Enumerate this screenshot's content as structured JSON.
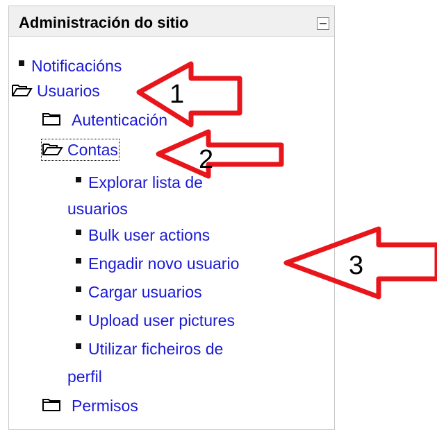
{
  "block": {
    "title": "Administración do sitio",
    "toggle_icon": "collapse-icon"
  },
  "tree": {
    "notifications": "Notificacións",
    "users": "Usuarios",
    "authentication": "Autenticación",
    "accounts": "Contas",
    "browse_list_line1": "Explorar lista de",
    "browse_list_line2": "usuarios",
    "bulk_actions": "Bulk user actions",
    "add_user": "Engadir novo usuario",
    "upload_users": "Cargar usuarios",
    "upload_pictures": "Upload user pictures",
    "profile_fields_line1": "Utilizar ficheiros de",
    "profile_fields_line2": "perfil",
    "permissions": "Permisos"
  },
  "annotations": {
    "arrow_color": "#e8161b",
    "labels": [
      "1",
      "2",
      "3"
    ]
  }
}
